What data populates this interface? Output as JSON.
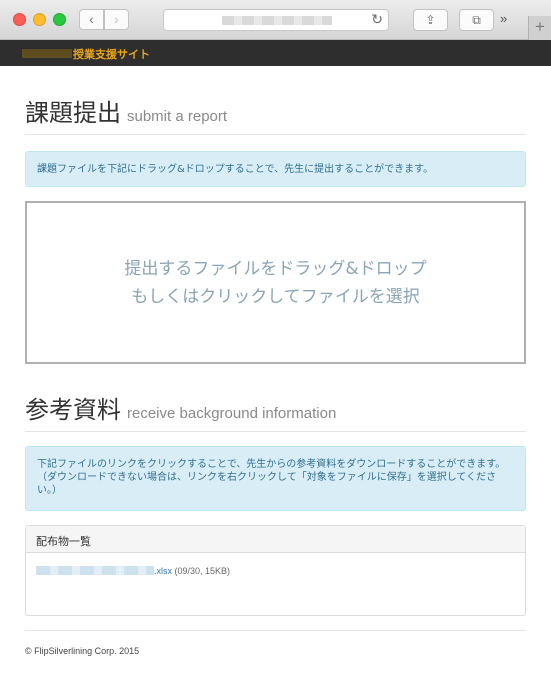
{
  "browser": {
    "back_glyph": "‹",
    "forward_glyph": "›",
    "reload_icon": "↻",
    "share_icon": "⇪",
    "tabs_icon": "⧉",
    "more_glyph": "»",
    "newtab_glyph": "+"
  },
  "site": {
    "title": "授業支援サイト",
    "accent_color": "#e8a51c"
  },
  "submit": {
    "heading": "課題提出",
    "subheading": "submit a report",
    "info": "課題ファイルを下記にドラッグ&ドロップすることで、先生に提出することができます。",
    "drop_line1": "提出するファイルをドラッグ&ドロップ",
    "drop_line2": "もしくはクリックしてファイルを選択"
  },
  "reference": {
    "heading": "参考資料",
    "subheading": "receive background information",
    "info_line1": "下記ファイルのリンクをクリックすることで、先生からの参考資料をダウンロードすることができます。",
    "info_line2": "（ダウンロードできない場合は、リンクを右クリックして「対象をファイルに保存」を選択してくださ",
    "info_line3": "い。）",
    "panel_title": "配布物一覧",
    "files": [
      {
        "ext": ".xlsx",
        "meta": "(09/30, 15KB)"
      }
    ]
  },
  "footer": {
    "copyright": "© FlipSilverlining Corp. 2015"
  }
}
